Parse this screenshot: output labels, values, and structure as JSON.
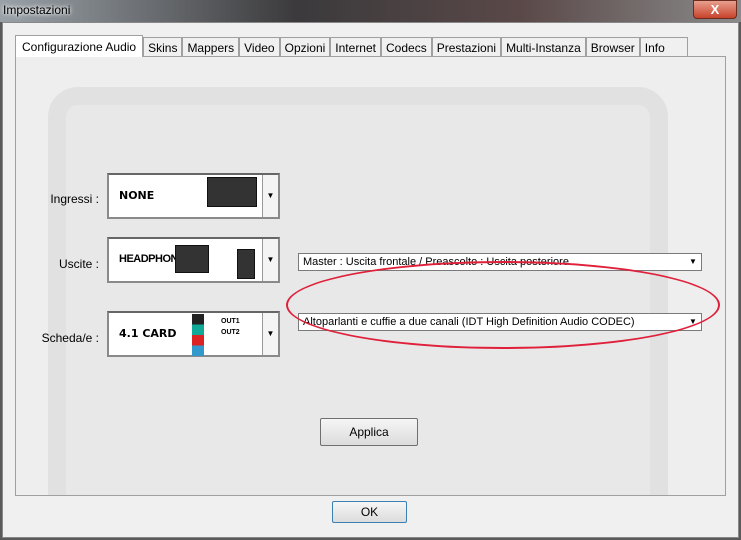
{
  "window": {
    "title": "Impostazioni",
    "close": "X"
  },
  "tabs": [
    "Configurazione Audio",
    "Skins",
    "Mappers",
    "Video",
    "Opzioni",
    "Internet",
    "Codecs",
    "Prestazioni",
    "Multi-Instanza",
    "Browser",
    "Info"
  ],
  "audio": {
    "inputs_label": "Ingressi :",
    "inputs_value": "NONE",
    "outputs_label": "Uscite :",
    "outputs_value": "HEADPHONES",
    "card_label": "Scheda/e :",
    "card_value": "4.1 CARD",
    "out1": "OUT1",
    "out2": "OUT2",
    "routing": "Master : Uscita frontale / Preascolto : Uscita posteriore",
    "device": "Altoparlanti e cuffie a due canali (IDT High Definition Audio CODEC)",
    "apply": "Applica"
  },
  "ok": "OK",
  "colors": {
    "highlight": "#e0203a"
  }
}
